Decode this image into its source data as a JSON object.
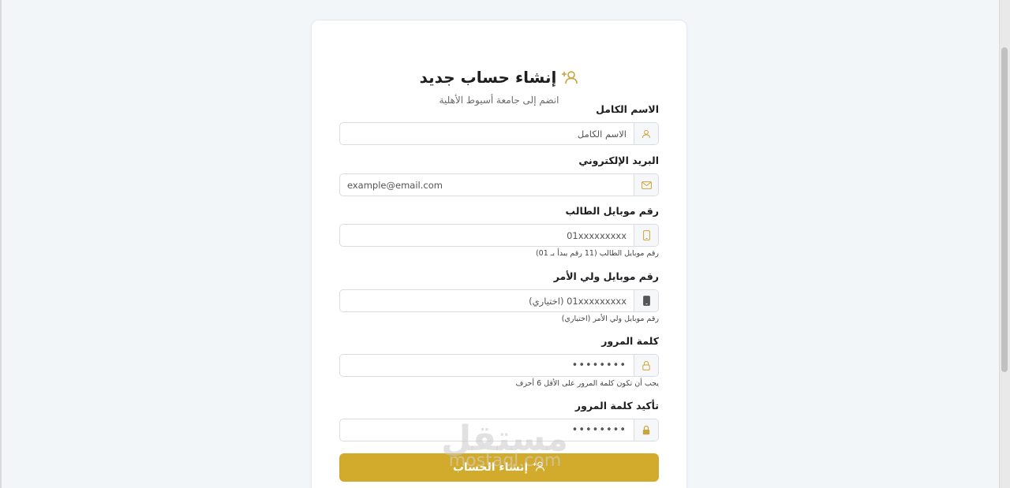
{
  "form": {
    "title": "إنشاء حساب جديد",
    "subtitle": "انضم إلى جامعة أسيوط الأهلية",
    "fields": [
      {
        "label": "الاسم الكامل",
        "placeholder": "الاسم الكامل",
        "icon": "user-icon",
        "hint": ""
      },
      {
        "label": "البريد الإلكتروني",
        "placeholder": "example@email.com",
        "icon": "envelope-icon",
        "hint": ""
      },
      {
        "label": "رقم موبايل الطالب",
        "placeholder": "01xxxxxxxxx",
        "icon": "mobile-icon",
        "hint": "رقم موبايل الطالب (11 رقم يبدأ بـ 01)"
      },
      {
        "label": "رقم موبايل ولي الأمر",
        "placeholder": "01xxxxxxxxx (اختياري)",
        "icon": "mobile-filled-icon",
        "hint": "رقم موبايل ولي الأمر (اختياري)"
      },
      {
        "label": "كلمة المرور",
        "placeholder": "••••••••",
        "icon": "lock-icon",
        "hint": "يجب أن تكون كلمة المرور على الأقل 6 أحرف"
      },
      {
        "label": "تأكيد كلمة المرور",
        "placeholder": "••••••••",
        "icon": "lock-filled-icon",
        "hint": ""
      }
    ],
    "submit_label": "إنشاء الحساب"
  },
  "watermark": {
    "main": "مستقل",
    "sub": "mostaql.com"
  },
  "colors": {
    "accent": "#d2aa2c",
    "page_bg": "#f3f6f9",
    "card_bg": "#ffffff"
  }
}
